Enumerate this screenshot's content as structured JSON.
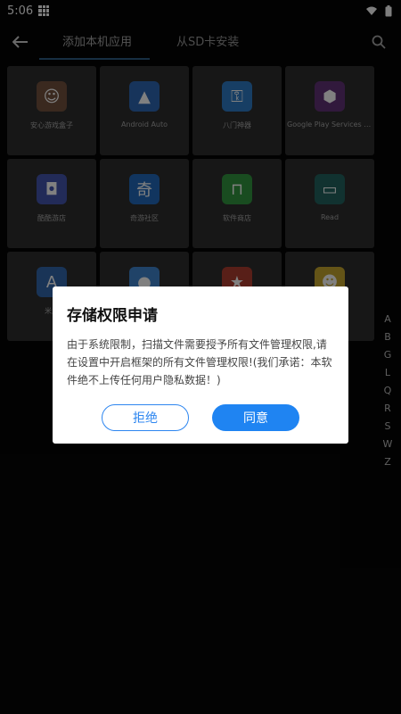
{
  "status": {
    "time": "5:06"
  },
  "topbar": {
    "tabs": [
      {
        "label": "添加本机应用"
      },
      {
        "label": "从SD卡安装"
      }
    ]
  },
  "apps": [
    {
      "label": "安心游戏盒子",
      "icon": "game-box-icon",
      "color": "#6b4b3a",
      "glyph": "☺"
    },
    {
      "label": "Android Auto",
      "icon": "android-auto-icon",
      "color": "#2b5fa6",
      "glyph": "▲"
    },
    {
      "label": "八门神器",
      "icon": "key-icon",
      "color": "#2a72b6",
      "glyph": "⚿"
    },
    {
      "label": "Google Play Services for",
      "icon": "play-services-icon",
      "color": "#5a2f6d",
      "glyph": "⬢"
    },
    {
      "label": "酷酷游店",
      "icon": "shield-app-icon",
      "color": "#3f4fa0",
      "glyph": "◘"
    },
    {
      "label": "奇游社区",
      "icon": "qi-app-icon",
      "color": "#1f62ad",
      "glyph": "奇"
    },
    {
      "label": "软件商店",
      "icon": "store-bag-icon",
      "color": "#2f8a3b",
      "glyph": "⊓"
    },
    {
      "label": "Read",
      "icon": "read-app-icon",
      "color": "#1f5c58",
      "glyph": "▭"
    },
    {
      "label": "米之",
      "icon": "a-logo-icon",
      "color": "#2f5f9e",
      "glyph": "A"
    },
    {
      "label": "",
      "icon": "circle-app-icon",
      "color": "#3b7bbd",
      "glyph": "●"
    },
    {
      "label": "",
      "icon": "red-app-icon",
      "color": "#a03a2c",
      "glyph": "★"
    },
    {
      "label": "",
      "icon": "cartoon-app-icon",
      "color": "#b79a2a",
      "glyph": "☻"
    }
  ],
  "alpha_index": [
    "A",
    "B",
    "G",
    "L",
    "Q",
    "R",
    "S",
    "W",
    "Z"
  ],
  "dialog": {
    "title": "存储权限申请",
    "body": "由于系统限制，扫描文件需要授予所有文件管理权限,请在设置中开启框架的所有文件管理权限!(我们承诺：本软件绝不上传任何用户隐私数据！)",
    "refuse_label": "拒绝",
    "agree_label": "同意"
  },
  "colors": {
    "primary_blue": "#1f84f2",
    "tile_bg": "#2b2b2b",
    "tab_indicator": "#2a5578"
  }
}
